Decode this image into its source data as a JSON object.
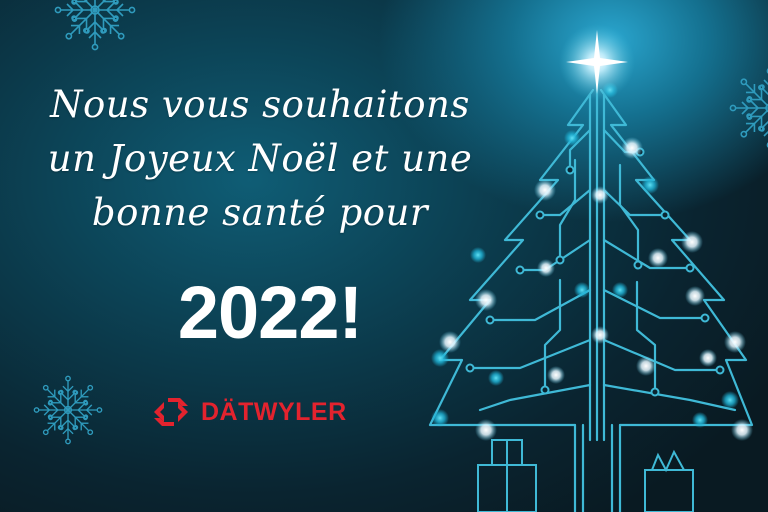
{
  "greeting": {
    "line1": "Nous vous souhaitons",
    "line2": "un Joyeux Noël et une",
    "line3": "bonne santé pour",
    "year": "2022!"
  },
  "logo": {
    "wordmark": "DÄTWYLER",
    "color": "#e3232e"
  },
  "colors": {
    "background": "#0a2430",
    "glow": "#2aa6cf",
    "circuit": "#3fb9d6",
    "snowflake": "#2f9bbd"
  },
  "icons": [
    "snowflake-icon",
    "circuit-christmas-tree",
    "star-icon",
    "gift-box-icon",
    "datwyler-logo-icon"
  ]
}
